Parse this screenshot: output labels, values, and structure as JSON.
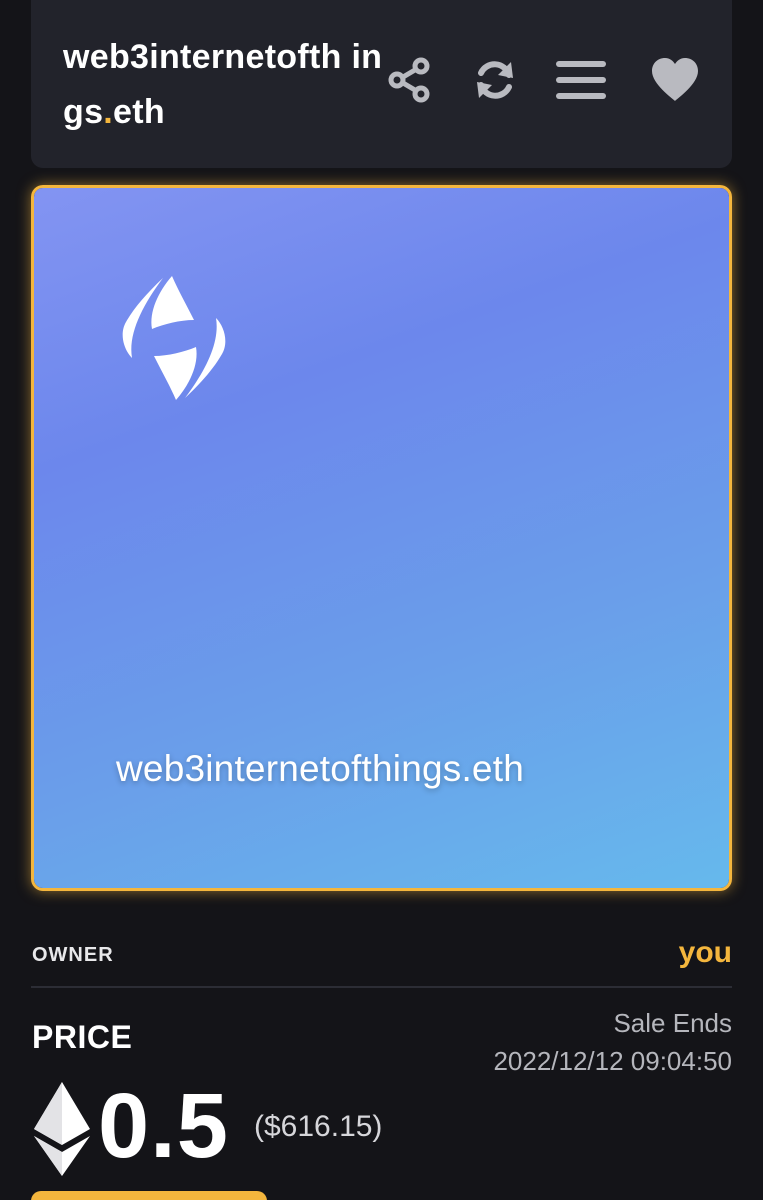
{
  "header": {
    "title_main": "web3internetofth\nings",
    "title_dot": ".",
    "title_tld": "eth",
    "icons": [
      "share-icon",
      "refresh-icon",
      "menu-icon",
      "heart-icon"
    ]
  },
  "artwork": {
    "name": "web3internetofthings.eth",
    "logo": "ens-logo-icon",
    "gradient": [
      "#8394f2",
      "#6c87ec",
      "#6a9eea",
      "#66b9ec"
    ]
  },
  "owner": {
    "label": "OWNER",
    "value": "you"
  },
  "price": {
    "label": "PRICE",
    "amount": "0.5",
    "usd": "($616.15)",
    "currency_icon": "ethereum-icon"
  },
  "sale": {
    "label": "Sale Ends",
    "ends": "2022/12/12 09:04:50"
  },
  "colors": {
    "accent": "#f4b63d",
    "background": "#141418",
    "card": "#22232b",
    "icon": "#b9bac0"
  }
}
